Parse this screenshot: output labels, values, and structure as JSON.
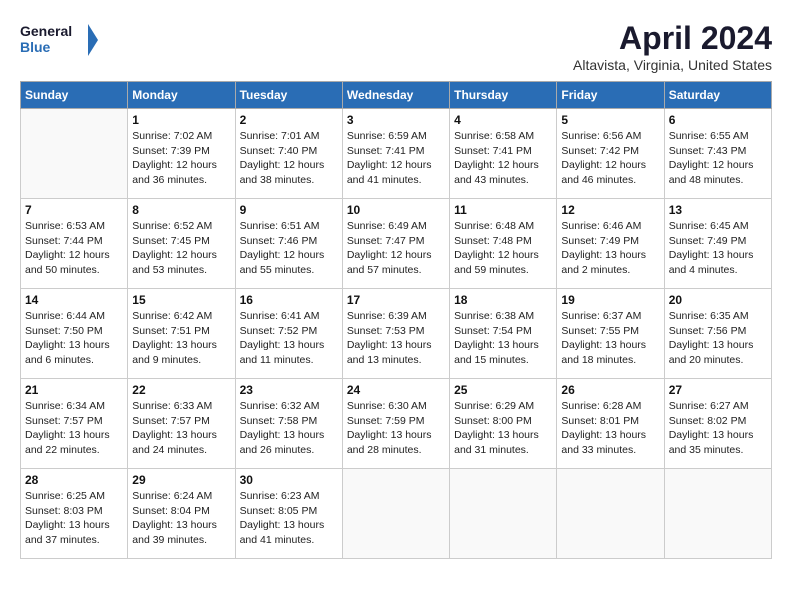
{
  "header": {
    "logo_line1": "General",
    "logo_line2": "Blue",
    "month_title": "April 2024",
    "location": "Altavista, Virginia, United States"
  },
  "weekdays": [
    "Sunday",
    "Monday",
    "Tuesday",
    "Wednesday",
    "Thursday",
    "Friday",
    "Saturday"
  ],
  "weeks": [
    [
      {
        "day": "",
        "info": ""
      },
      {
        "day": "1",
        "info": "Sunrise: 7:02 AM\nSunset: 7:39 PM\nDaylight: 12 hours\nand 36 minutes."
      },
      {
        "day": "2",
        "info": "Sunrise: 7:01 AM\nSunset: 7:40 PM\nDaylight: 12 hours\nand 38 minutes."
      },
      {
        "day": "3",
        "info": "Sunrise: 6:59 AM\nSunset: 7:41 PM\nDaylight: 12 hours\nand 41 minutes."
      },
      {
        "day": "4",
        "info": "Sunrise: 6:58 AM\nSunset: 7:41 PM\nDaylight: 12 hours\nand 43 minutes."
      },
      {
        "day": "5",
        "info": "Sunrise: 6:56 AM\nSunset: 7:42 PM\nDaylight: 12 hours\nand 46 minutes."
      },
      {
        "day": "6",
        "info": "Sunrise: 6:55 AM\nSunset: 7:43 PM\nDaylight: 12 hours\nand 48 minutes."
      }
    ],
    [
      {
        "day": "7",
        "info": "Sunrise: 6:53 AM\nSunset: 7:44 PM\nDaylight: 12 hours\nand 50 minutes."
      },
      {
        "day": "8",
        "info": "Sunrise: 6:52 AM\nSunset: 7:45 PM\nDaylight: 12 hours\nand 53 minutes."
      },
      {
        "day": "9",
        "info": "Sunrise: 6:51 AM\nSunset: 7:46 PM\nDaylight: 12 hours\nand 55 minutes."
      },
      {
        "day": "10",
        "info": "Sunrise: 6:49 AM\nSunset: 7:47 PM\nDaylight: 12 hours\nand 57 minutes."
      },
      {
        "day": "11",
        "info": "Sunrise: 6:48 AM\nSunset: 7:48 PM\nDaylight: 12 hours\nand 59 minutes."
      },
      {
        "day": "12",
        "info": "Sunrise: 6:46 AM\nSunset: 7:49 PM\nDaylight: 13 hours\nand 2 minutes."
      },
      {
        "day": "13",
        "info": "Sunrise: 6:45 AM\nSunset: 7:49 PM\nDaylight: 13 hours\nand 4 minutes."
      }
    ],
    [
      {
        "day": "14",
        "info": "Sunrise: 6:44 AM\nSunset: 7:50 PM\nDaylight: 13 hours\nand 6 minutes."
      },
      {
        "day": "15",
        "info": "Sunrise: 6:42 AM\nSunset: 7:51 PM\nDaylight: 13 hours\nand 9 minutes."
      },
      {
        "day": "16",
        "info": "Sunrise: 6:41 AM\nSunset: 7:52 PM\nDaylight: 13 hours\nand 11 minutes."
      },
      {
        "day": "17",
        "info": "Sunrise: 6:39 AM\nSunset: 7:53 PM\nDaylight: 13 hours\nand 13 minutes."
      },
      {
        "day": "18",
        "info": "Sunrise: 6:38 AM\nSunset: 7:54 PM\nDaylight: 13 hours\nand 15 minutes."
      },
      {
        "day": "19",
        "info": "Sunrise: 6:37 AM\nSunset: 7:55 PM\nDaylight: 13 hours\nand 18 minutes."
      },
      {
        "day": "20",
        "info": "Sunrise: 6:35 AM\nSunset: 7:56 PM\nDaylight: 13 hours\nand 20 minutes."
      }
    ],
    [
      {
        "day": "21",
        "info": "Sunrise: 6:34 AM\nSunset: 7:57 PM\nDaylight: 13 hours\nand 22 minutes."
      },
      {
        "day": "22",
        "info": "Sunrise: 6:33 AM\nSunset: 7:57 PM\nDaylight: 13 hours\nand 24 minutes."
      },
      {
        "day": "23",
        "info": "Sunrise: 6:32 AM\nSunset: 7:58 PM\nDaylight: 13 hours\nand 26 minutes."
      },
      {
        "day": "24",
        "info": "Sunrise: 6:30 AM\nSunset: 7:59 PM\nDaylight: 13 hours\nand 28 minutes."
      },
      {
        "day": "25",
        "info": "Sunrise: 6:29 AM\nSunset: 8:00 PM\nDaylight: 13 hours\nand 31 minutes."
      },
      {
        "day": "26",
        "info": "Sunrise: 6:28 AM\nSunset: 8:01 PM\nDaylight: 13 hours\nand 33 minutes."
      },
      {
        "day": "27",
        "info": "Sunrise: 6:27 AM\nSunset: 8:02 PM\nDaylight: 13 hours\nand 35 minutes."
      }
    ],
    [
      {
        "day": "28",
        "info": "Sunrise: 6:25 AM\nSunset: 8:03 PM\nDaylight: 13 hours\nand 37 minutes."
      },
      {
        "day": "29",
        "info": "Sunrise: 6:24 AM\nSunset: 8:04 PM\nDaylight: 13 hours\nand 39 minutes."
      },
      {
        "day": "30",
        "info": "Sunrise: 6:23 AM\nSunset: 8:05 PM\nDaylight: 13 hours\nand 41 minutes."
      },
      {
        "day": "",
        "info": ""
      },
      {
        "day": "",
        "info": ""
      },
      {
        "day": "",
        "info": ""
      },
      {
        "day": "",
        "info": ""
      }
    ]
  ]
}
